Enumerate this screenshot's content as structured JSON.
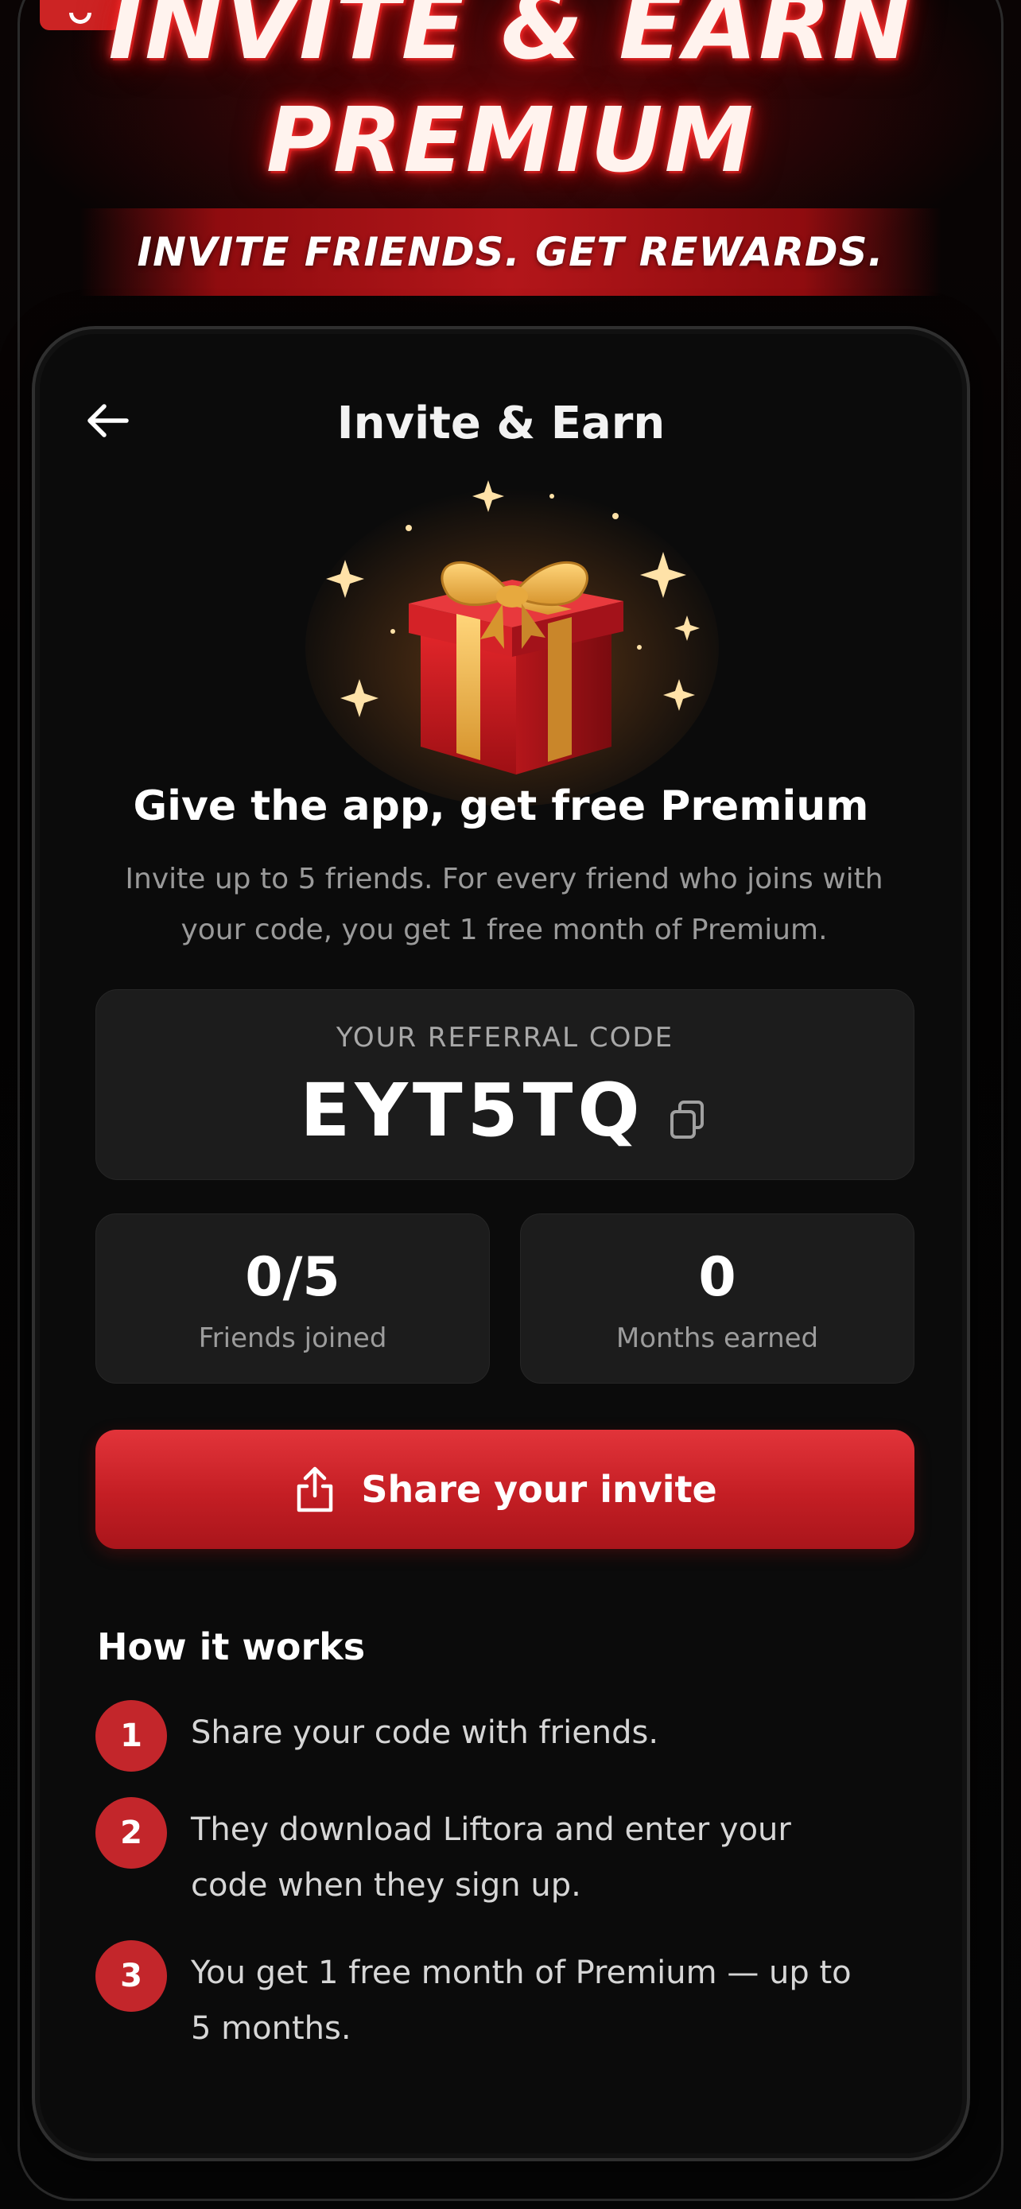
{
  "banner": {
    "title_line1": "INVITE & EARN",
    "title_line2": "PREMIUM",
    "tagline": "INVITE FRIENDS. GET REWARDS."
  },
  "header": {
    "back_icon": "arrow-left-icon",
    "title": "Invite & Earn"
  },
  "promo": {
    "illustration": "gift-box-icon",
    "heading": "Give the app, get free Premium",
    "description": "Invite up to 5 friends. For every friend who joins with your code, you get 1 free month of Premium."
  },
  "referral": {
    "label": "YOUR REFERRAL CODE",
    "code": "EYT5TQ",
    "copy_icon": "copy-icon"
  },
  "stats": {
    "friends_value": "0/5",
    "friends_label": "Friends joined",
    "months_value": "0",
    "months_label": "Months earned"
  },
  "share": {
    "icon": "share-icon",
    "label": "Share your invite"
  },
  "how_it_works": {
    "heading": "How it works",
    "steps": [
      {
        "number": "1",
        "text": "Share your code with friends."
      },
      {
        "number": "2",
        "text": "They download Liftora and enter your code when they sign up."
      },
      {
        "number": "3",
        "text": "You get 1 free month of Premium — up to 5 months."
      }
    ]
  },
  "colors": {
    "accent": "#c41e24",
    "background": "#050505",
    "card": "#1c1c1c",
    "muted_text": "#9a9a9a"
  }
}
